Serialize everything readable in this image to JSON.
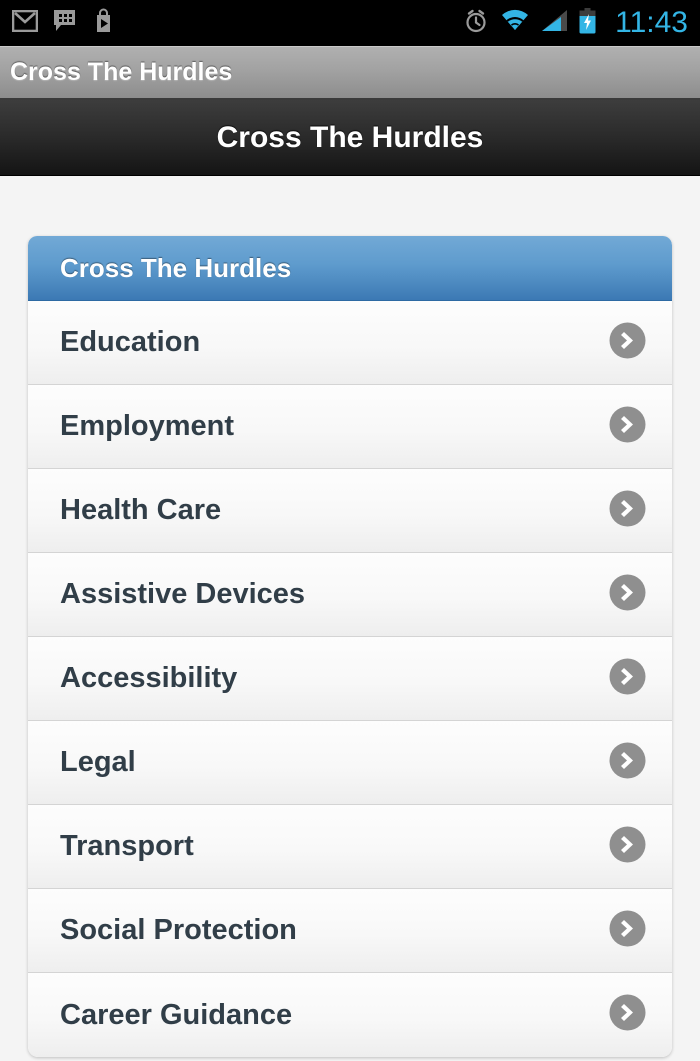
{
  "statusbar": {
    "time": "11:43",
    "left_icons": [
      {
        "name": "gmail-icon",
        "label": "Gmail"
      },
      {
        "name": "bbm-chat-icon",
        "label": "BBM"
      },
      {
        "name": "play-store-icon",
        "label": "Play Store"
      }
    ],
    "right_icons": [
      {
        "name": "alarm-clock-icon",
        "label": "Alarm set"
      },
      {
        "name": "wifi-icon",
        "label": "Wi-Fi"
      },
      {
        "name": "cellular-signal-icon",
        "label": "Signal"
      },
      {
        "name": "battery-charging-icon",
        "label": "Battery charging"
      }
    ],
    "colors": {
      "accent": "#33b5e5",
      "icon_gray": "#9a9a9a",
      "background": "#000000"
    }
  },
  "window_bar": {
    "title": "Cross The Hurdles"
  },
  "action_bar": {
    "title": "Cross The Hurdles"
  },
  "list_card": {
    "header_title": "Cross The Hurdles",
    "header_color": "#5e9bcd",
    "arrow_icon": "chevron-right-icon",
    "items": [
      {
        "label": "Education"
      },
      {
        "label": "Employment"
      },
      {
        "label": "Health Care"
      },
      {
        "label": "Assistive Devices"
      },
      {
        "label": "Accessibility"
      },
      {
        "label": "Legal"
      },
      {
        "label": "Transport"
      },
      {
        "label": "Social Protection"
      },
      {
        "label": "Career Guidance"
      }
    ]
  }
}
